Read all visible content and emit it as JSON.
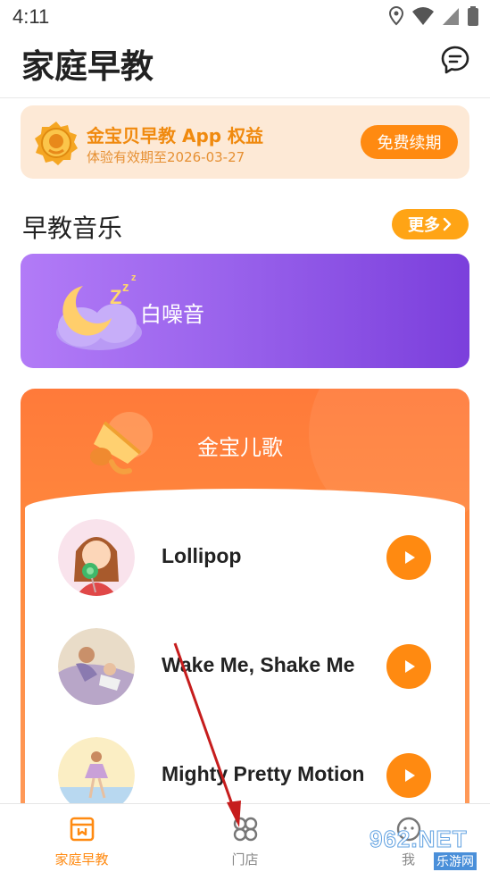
{
  "status": {
    "time": "4:11"
  },
  "header": {
    "title": "家庭早教"
  },
  "vip": {
    "title": "金宝贝早教 App 权益",
    "subtitle": "体验有效期至2026-03-27",
    "renew_label": "免费续期"
  },
  "music": {
    "section_title": "早教音乐",
    "more_label": "更多"
  },
  "noise": {
    "label": "白噪音"
  },
  "songs": {
    "title": "金宝儿歌",
    "items": [
      {
        "name": "Lollipop"
      },
      {
        "name": "Wake Me, Shake Me"
      },
      {
        "name": "Mighty Pretty Motion"
      }
    ]
  },
  "tabbar": {
    "tabs": [
      {
        "label": "家庭早教",
        "icon": "home-calendar-icon",
        "active": true
      },
      {
        "label": "门店",
        "icon": "store-grid-icon",
        "active": false
      },
      {
        "label": "我",
        "icon": "profile-face-icon",
        "active": false
      }
    ]
  },
  "watermark": {
    "main": "962.NET",
    "sub": "乐游网"
  },
  "colors": {
    "accent": "#ff8a11",
    "vip_bg": "#fde9d6",
    "noise_card": "#9a63ec",
    "songs_card": "#ff7a3a",
    "annotation_arrow": "#c61d1d"
  }
}
